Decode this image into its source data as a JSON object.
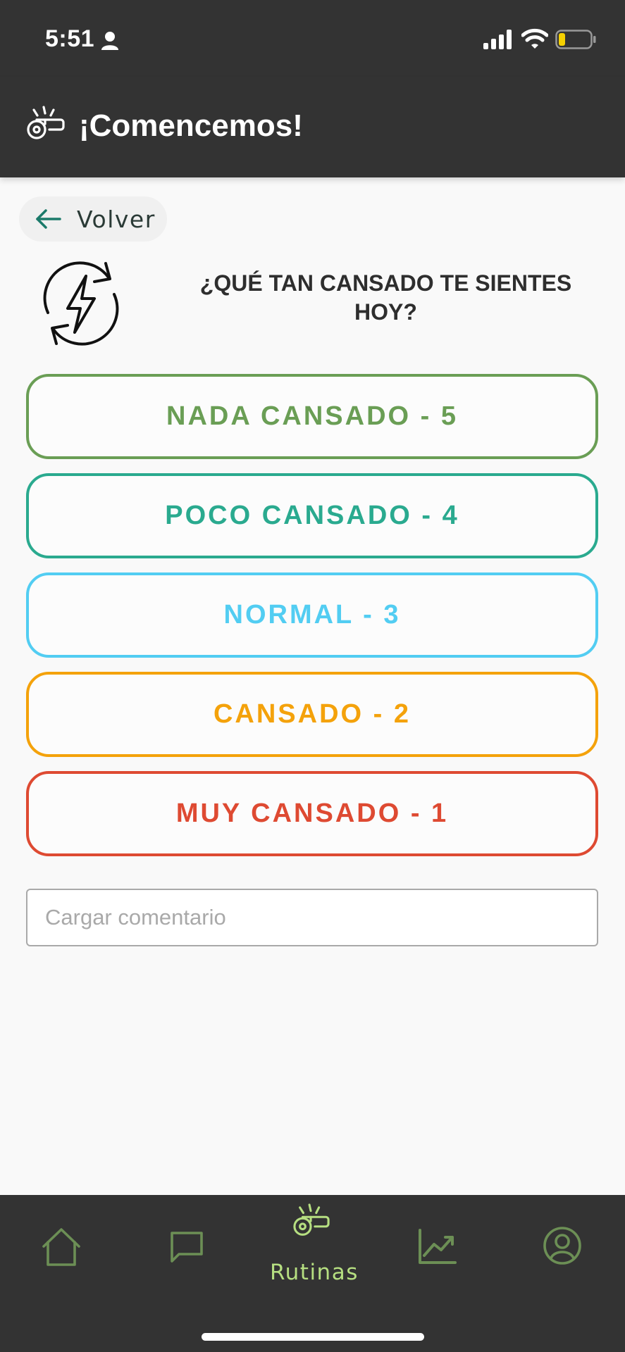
{
  "status_bar": {
    "time": "5:51",
    "icons": [
      "person-icon",
      "signal-icon",
      "wifi-icon",
      "battery-icon"
    ],
    "battery_level": 0.2
  },
  "header": {
    "title": "¡Comencemos!",
    "icon": "whistle-icon"
  },
  "back_button": {
    "label": "Volver",
    "icon": "arrow-left-icon"
  },
  "question": {
    "icon": "energy-cycle-icon",
    "text": "¿QUÉ TAN CANSADO TE SIENTES HOY?"
  },
  "options": [
    {
      "label": "NADA CANSADO - 5",
      "color": "#6a9e55"
    },
    {
      "label": "POCO CANSADO - 4",
      "color": "#2aaa8f"
    },
    {
      "label": "NORMAL - 3",
      "color": "#52cdf2"
    },
    {
      "label": "CANSADO - 2",
      "color": "#f4a20b"
    },
    {
      "label": "MUY CANSADO - 1",
      "color": "#de4a32"
    }
  ],
  "comment": {
    "placeholder": "Cargar comentario",
    "value": ""
  },
  "tab_bar": {
    "tabs": [
      {
        "id": "home",
        "icon": "home-icon"
      },
      {
        "id": "chat",
        "icon": "chat-icon"
      },
      {
        "id": "rutinas",
        "icon": "whistle-icon",
        "label": "Rutinas",
        "active": true
      },
      {
        "id": "progress",
        "icon": "chart-icon"
      },
      {
        "id": "profile",
        "icon": "user-circle-icon"
      }
    ],
    "active_color": "#b6df81",
    "inactive_color": "#6c8f55"
  }
}
